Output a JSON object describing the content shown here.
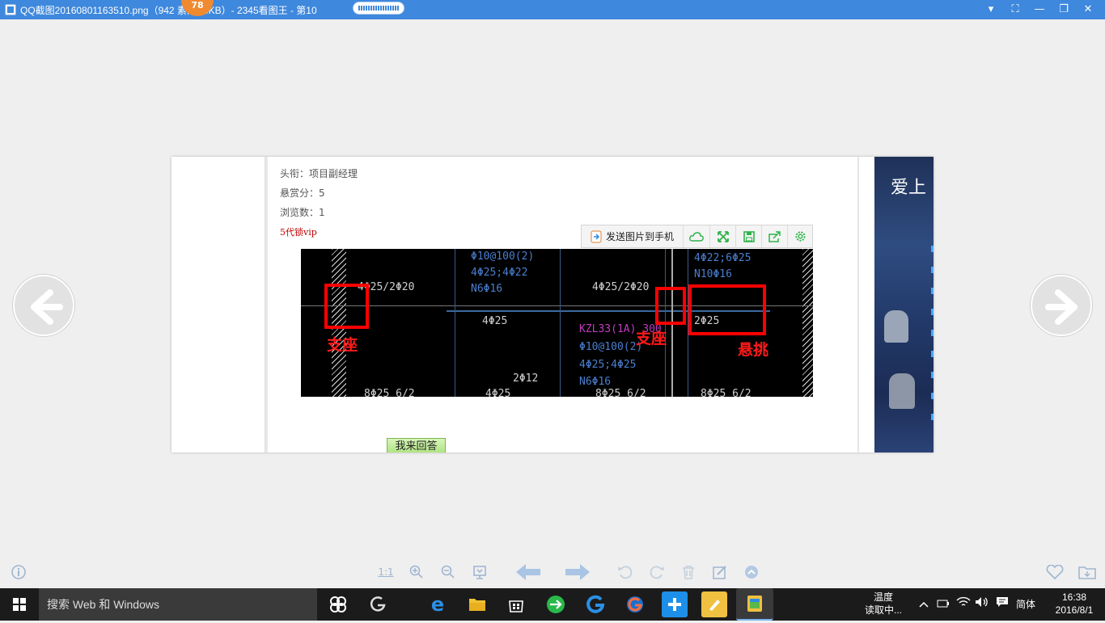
{
  "window": {
    "title": "QQ截图20160801163510.png（942    素, 146KB）- 2345看图王 - 第10",
    "badge": "78",
    "controls": [
      "▾",
      "⛶",
      "—",
      "❐",
      "✕"
    ]
  },
  "page": {
    "info": [
      "头衔：项目副经理",
      "悬赏分：5",
      "浏览数：1"
    ],
    "vip": "5代锁vip",
    "answer_button": "我来回答",
    "photo_text": "爱上"
  },
  "image_toolbar": {
    "send_label": "发送图片到手机",
    "icons": [
      "cloud-icon",
      "expand-icon",
      "save-icon",
      "share-icon",
      "settings-icon"
    ]
  },
  "cad": {
    "texts": [
      {
        "t": "4Φ25/2Φ20",
        "c": ""
      },
      {
        "t": "Φ10@100(2)",
        "c": "blue"
      },
      {
        "t": "4Φ25;4Φ22",
        "c": "blue"
      },
      {
        "t": "N6Φ16",
        "c": "blue"
      },
      {
        "t": "4Φ25/2Φ20",
        "c": ""
      },
      {
        "t": "4Φ22;6Φ25",
        "c": "blue"
      },
      {
        "t": "N10Φ16",
        "c": "blue"
      },
      {
        "t": "4Φ25",
        "c": ""
      },
      {
        "t": "KZL33(1A) 300",
        "c": "mag"
      },
      {
        "t": "Φ10@100(2)",
        "c": "blue"
      },
      {
        "t": "4Φ25;4Φ25",
        "c": "blue"
      },
      {
        "t": "N6Φ16",
        "c": "blue"
      },
      {
        "t": "2Φ25",
        "c": ""
      },
      {
        "t": "2Φ12",
        "c": ""
      },
      {
        "t": "8Φ25 6/2",
        "c": ""
      },
      {
        "t": "4Φ25",
        "c": ""
      },
      {
        "t": "8Φ25 6/2",
        "c": ""
      },
      {
        "t": "8Φ25 6/2",
        "c": ""
      }
    ],
    "labels": [
      "支座",
      "支座",
      "悬挑"
    ]
  },
  "bottom_toolbar": {
    "ratio_label": "1:1",
    "icons": [
      "info-icon",
      "zoom-in-icon",
      "zoom-out-icon",
      "fit-icon",
      "prev-icon",
      "next-icon",
      "rotate-left-icon",
      "rotate-right-icon",
      "delete-icon",
      "edit-icon",
      "up-icon",
      "favorite-icon",
      "folder-icon"
    ]
  },
  "taskbar": {
    "search_placeholder": "搜索 Web 和 Windows",
    "weather_line1": "温度",
    "weather_line2": "读取中...",
    "ime": "简体",
    "time": "16:38",
    "date": "2016/8/1"
  },
  "colors": {
    "titlebar": "#3e88dd",
    "accent_red": "#ff0000",
    "taskbar": "#1b1b1b"
  }
}
